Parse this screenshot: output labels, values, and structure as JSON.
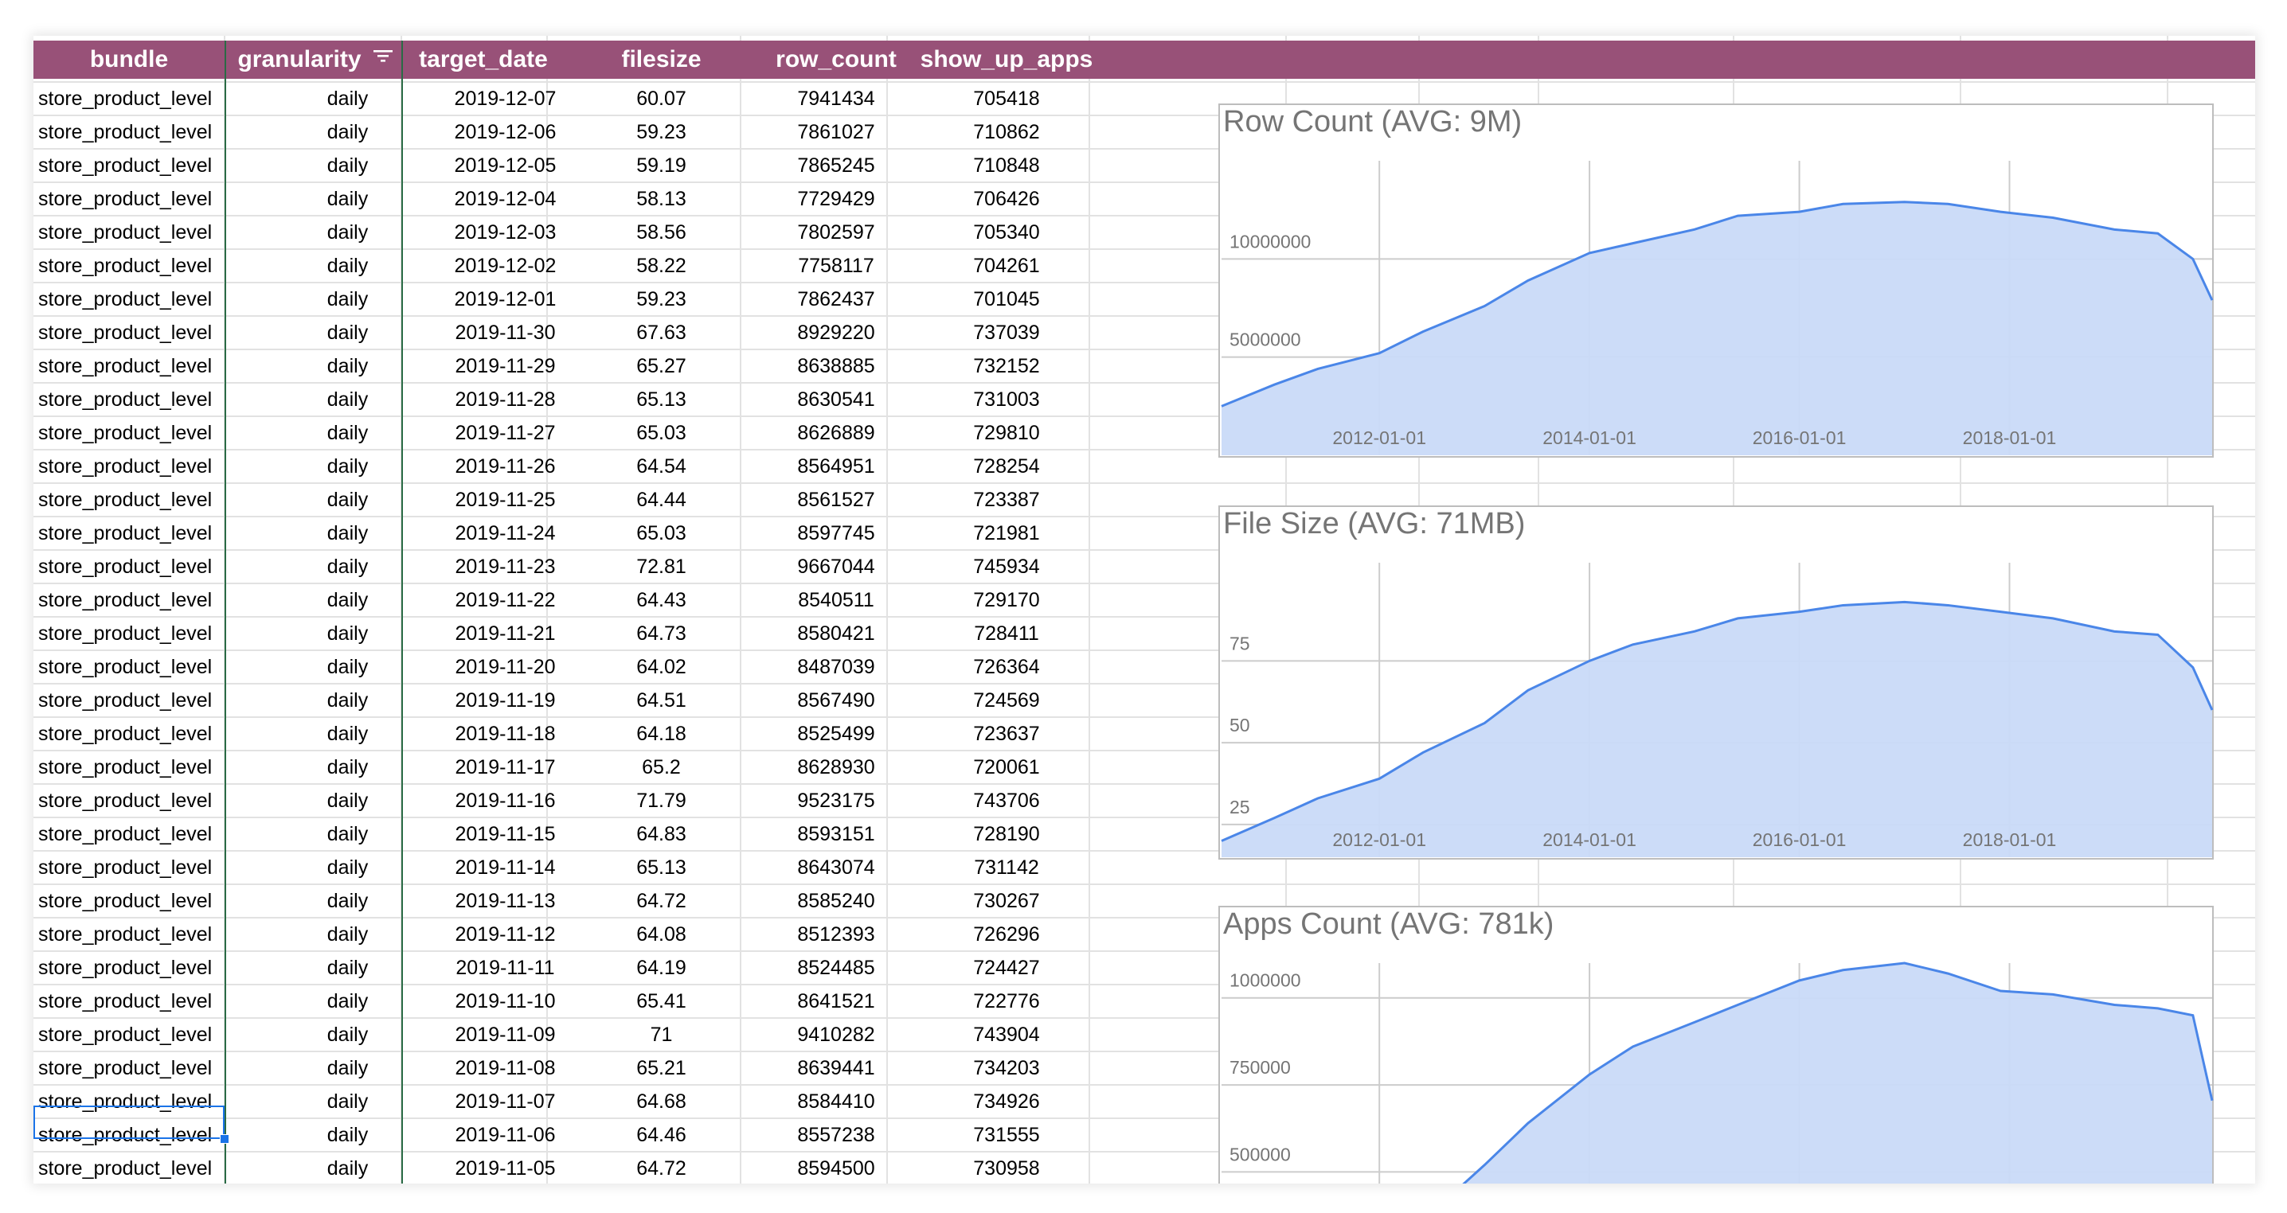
{
  "columns": [
    {
      "key": "bundle",
      "label": "bundle"
    },
    {
      "key": "granularity",
      "label": "granularity",
      "filter": true
    },
    {
      "key": "target_date",
      "label": "target_date"
    },
    {
      "key": "filesize",
      "label": "filesize"
    },
    {
      "key": "row_count",
      "label": "row_count"
    },
    {
      "key": "show_up_apps",
      "label": "show_up_apps"
    }
  ],
  "rows": [
    {
      "bundle": "store_product_level",
      "granularity": "daily",
      "target_date": "2019-12-07",
      "filesize": "60.07",
      "row_count": "7941434",
      "show_up_apps": "705418"
    },
    {
      "bundle": "store_product_level",
      "granularity": "daily",
      "target_date": "2019-12-06",
      "filesize": "59.23",
      "row_count": "7861027",
      "show_up_apps": "710862"
    },
    {
      "bundle": "store_product_level",
      "granularity": "daily",
      "target_date": "2019-12-05",
      "filesize": "59.19",
      "row_count": "7865245",
      "show_up_apps": "710848"
    },
    {
      "bundle": "store_product_level",
      "granularity": "daily",
      "target_date": "2019-12-04",
      "filesize": "58.13",
      "row_count": "7729429",
      "show_up_apps": "706426"
    },
    {
      "bundle": "store_product_level",
      "granularity": "daily",
      "target_date": "2019-12-03",
      "filesize": "58.56",
      "row_count": "7802597",
      "show_up_apps": "705340"
    },
    {
      "bundle": "store_product_level",
      "granularity": "daily",
      "target_date": "2019-12-02",
      "filesize": "58.22",
      "row_count": "7758117",
      "show_up_apps": "704261"
    },
    {
      "bundle": "store_product_level",
      "granularity": "daily",
      "target_date": "2019-12-01",
      "filesize": "59.23",
      "row_count": "7862437",
      "show_up_apps": "701045"
    },
    {
      "bundle": "store_product_level",
      "granularity": "daily",
      "target_date": "2019-11-30",
      "filesize": "67.63",
      "row_count": "8929220",
      "show_up_apps": "737039"
    },
    {
      "bundle": "store_product_level",
      "granularity": "daily",
      "target_date": "2019-11-29",
      "filesize": "65.27",
      "row_count": "8638885",
      "show_up_apps": "732152"
    },
    {
      "bundle": "store_product_level",
      "granularity": "daily",
      "target_date": "2019-11-28",
      "filesize": "65.13",
      "row_count": "8630541",
      "show_up_apps": "731003"
    },
    {
      "bundle": "store_product_level",
      "granularity": "daily",
      "target_date": "2019-11-27",
      "filesize": "65.03",
      "row_count": "8626889",
      "show_up_apps": "729810"
    },
    {
      "bundle": "store_product_level",
      "granularity": "daily",
      "target_date": "2019-11-26",
      "filesize": "64.54",
      "row_count": "8564951",
      "show_up_apps": "728254"
    },
    {
      "bundle": "store_product_level",
      "granularity": "daily",
      "target_date": "2019-11-25",
      "filesize": "64.44",
      "row_count": "8561527",
      "show_up_apps": "723387"
    },
    {
      "bundle": "store_product_level",
      "granularity": "daily",
      "target_date": "2019-11-24",
      "filesize": "65.03",
      "row_count": "8597745",
      "show_up_apps": "721981"
    },
    {
      "bundle": "store_product_level",
      "granularity": "daily",
      "target_date": "2019-11-23",
      "filesize": "72.81",
      "row_count": "9667044",
      "show_up_apps": "745934"
    },
    {
      "bundle": "store_product_level",
      "granularity": "daily",
      "target_date": "2019-11-22",
      "filesize": "64.43",
      "row_count": "8540511",
      "show_up_apps": "729170"
    },
    {
      "bundle": "store_product_level",
      "granularity": "daily",
      "target_date": "2019-11-21",
      "filesize": "64.73",
      "row_count": "8580421",
      "show_up_apps": "728411"
    },
    {
      "bundle": "store_product_level",
      "granularity": "daily",
      "target_date": "2019-11-20",
      "filesize": "64.02",
      "row_count": "8487039",
      "show_up_apps": "726364"
    },
    {
      "bundle": "store_product_level",
      "granularity": "daily",
      "target_date": "2019-11-19",
      "filesize": "64.51",
      "row_count": "8567490",
      "show_up_apps": "724569"
    },
    {
      "bundle": "store_product_level",
      "granularity": "daily",
      "target_date": "2019-11-18",
      "filesize": "64.18",
      "row_count": "8525499",
      "show_up_apps": "723637"
    },
    {
      "bundle": "store_product_level",
      "granularity": "daily",
      "target_date": "2019-11-17",
      "filesize": "65.2",
      "row_count": "8628930",
      "show_up_apps": "720061"
    },
    {
      "bundle": "store_product_level",
      "granularity": "daily",
      "target_date": "2019-11-16",
      "filesize": "71.79",
      "row_count": "9523175",
      "show_up_apps": "743706"
    },
    {
      "bundle": "store_product_level",
      "granularity": "daily",
      "target_date": "2019-11-15",
      "filesize": "64.83",
      "row_count": "8593151",
      "show_up_apps": "728190"
    },
    {
      "bundle": "store_product_level",
      "granularity": "daily",
      "target_date": "2019-11-14",
      "filesize": "65.13",
      "row_count": "8643074",
      "show_up_apps": "731142"
    },
    {
      "bundle": "store_product_level",
      "granularity": "daily",
      "target_date": "2019-11-13",
      "filesize": "64.72",
      "row_count": "8585240",
      "show_up_apps": "730267"
    },
    {
      "bundle": "store_product_level",
      "granularity": "daily",
      "target_date": "2019-11-12",
      "filesize": "64.08",
      "row_count": "8512393",
      "show_up_apps": "726296"
    },
    {
      "bundle": "store_product_level",
      "granularity": "daily",
      "target_date": "2019-11-11",
      "filesize": "64.19",
      "row_count": "8524485",
      "show_up_apps": "724427"
    },
    {
      "bundle": "store_product_level",
      "granularity": "daily",
      "target_date": "2019-11-10",
      "filesize": "65.41",
      "row_count": "8641521",
      "show_up_apps": "722776"
    },
    {
      "bundle": "store_product_level",
      "granularity": "daily",
      "target_date": "2019-11-09",
      "filesize": "71",
      "row_count": "9410282",
      "show_up_apps": "743904"
    },
    {
      "bundle": "store_product_level",
      "granularity": "daily",
      "target_date": "2019-11-08",
      "filesize": "65.21",
      "row_count": "8639441",
      "show_up_apps": "734203"
    },
    {
      "bundle": "store_product_level",
      "granularity": "daily",
      "target_date": "2019-11-07",
      "filesize": "64.68",
      "row_count": "8584410",
      "show_up_apps": "734926"
    },
    {
      "bundle": "store_product_level",
      "granularity": "daily",
      "target_date": "2019-11-06",
      "filesize": "64.46",
      "row_count": "8557238",
      "show_up_apps": "731555"
    },
    {
      "bundle": "store_product_level",
      "granularity": "daily",
      "target_date": "2019-11-05",
      "filesize": "64.72",
      "row_count": "8594500",
      "show_up_apps": "730958"
    }
  ],
  "colors": {
    "header_bg": "#985178",
    "header_text": "#ffffff",
    "grid_line": "#e2e2e2",
    "freeze_line": "#2a6b45",
    "selection": "#1a73e8",
    "series_line": "#4a86e8",
    "series_fill": "#c9daf8",
    "chart_text": "#757575"
  },
  "chart_data": [
    {
      "type": "area",
      "title": "Row Count (AVG: 9M)",
      "x_ticks": [
        "2012-01-01",
        "2014-01-01",
        "2016-01-01",
        "2018-01-01"
      ],
      "y_ticks": [
        5000000,
        10000000
      ],
      "xlim": [
        "2010-07-01",
        "2019-12-07"
      ],
      "ylim": [
        0,
        15000000
      ],
      "x": [
        "2010-07-01",
        "2011-01-01",
        "2011-06-01",
        "2012-01-01",
        "2012-06-01",
        "2013-01-01",
        "2013-06-01",
        "2014-01-01",
        "2014-06-01",
        "2015-01-01",
        "2015-06-01",
        "2016-01-01",
        "2016-06-01",
        "2017-01-01",
        "2017-06-01",
        "2017-12-01",
        "2018-06-01",
        "2019-01-01",
        "2019-06-01",
        "2019-10-01",
        "2019-12-07"
      ],
      "values": [
        2500000,
        3600000,
        4400000,
        5200000,
        6300000,
        7600000,
        8900000,
        10300000,
        10800000,
        11500000,
        12200000,
        12400000,
        12800000,
        12900000,
        12800000,
        12400000,
        12100000,
        11500000,
        11300000,
        10000000,
        7900000
      ]
    },
    {
      "type": "area",
      "title": "File Size (AVG: 71MB)",
      "x_ticks": [
        "2012-01-01",
        "2014-01-01",
        "2016-01-01",
        "2018-01-01"
      ],
      "y_ticks": [
        25,
        50,
        75
      ],
      "xlim": [
        "2010-07-01",
        "2019-12-07"
      ],
      "ylim": [
        15,
        105
      ],
      "x": [
        "2010-07-01",
        "2011-01-01",
        "2011-06-01",
        "2012-01-01",
        "2012-06-01",
        "2013-01-01",
        "2013-06-01",
        "2014-01-01",
        "2014-06-01",
        "2015-01-01",
        "2015-06-01",
        "2016-01-01",
        "2016-06-01",
        "2017-01-01",
        "2017-06-01",
        "2017-12-01",
        "2018-06-01",
        "2019-01-01",
        "2019-06-01",
        "2019-10-01",
        "2019-12-07"
      ],
      "values": [
        20,
        27,
        33,
        39,
        47,
        56,
        66,
        75,
        80,
        84,
        88,
        90,
        92,
        93,
        92,
        90,
        88,
        84,
        83,
        73,
        60
      ]
    },
    {
      "type": "area",
      "title": "Apps Count (AVG: 781k)",
      "x_ticks": [],
      "y_ticks": [
        500000,
        750000,
        1000000
      ],
      "xlim": [
        "2010-07-01",
        "2019-12-07"
      ],
      "ylim": [
        350000,
        1100000
      ],
      "x": [
        "2012-06-01",
        "2013-01-01",
        "2013-06-01",
        "2014-01-01",
        "2014-06-01",
        "2015-01-01",
        "2015-06-01",
        "2016-01-01",
        "2016-06-01",
        "2017-01-01",
        "2017-06-01",
        "2017-12-01",
        "2018-06-01",
        "2019-01-01",
        "2019-06-01",
        "2019-10-01",
        "2019-12-07"
      ],
      "values": [
        360000,
        520000,
        640000,
        780000,
        860000,
        930000,
        980000,
        1050000,
        1080000,
        1100000,
        1070000,
        1020000,
        1010000,
        980000,
        970000,
        950000,
        705000
      ]
    }
  ]
}
